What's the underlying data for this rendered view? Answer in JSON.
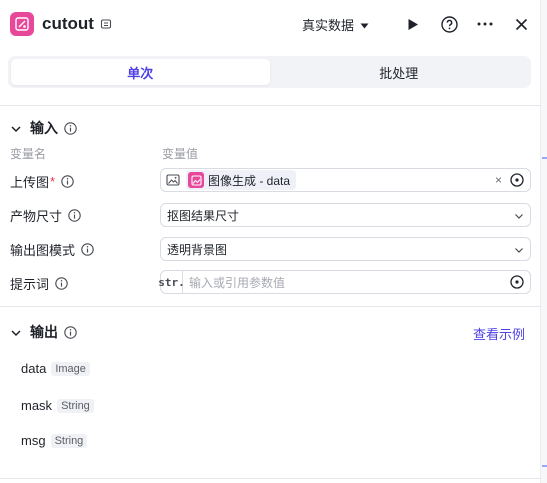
{
  "header": {
    "title": "cutout",
    "data_mode": "真实数据",
    "logo_icon": "magic-cut-icon",
    "accent": "#4e40e5",
    "brand": "#e8489a"
  },
  "tabs": [
    {
      "label": "单次",
      "active": true
    },
    {
      "label": "批处理",
      "active": false
    }
  ],
  "input": {
    "heading": "输入",
    "col_name": "变量名",
    "col_value": "变量值",
    "rows": [
      {
        "label": "上传图",
        "required": "*",
        "tag_text": "图像生成 - data"
      },
      {
        "label": "产物尺寸",
        "value": "抠图结果尺寸"
      },
      {
        "label": "输出图模式",
        "value": "透明背景图"
      },
      {
        "label": "提示词",
        "type_prefix": "str.",
        "placeholder": "输入或引用参数值"
      }
    ]
  },
  "output": {
    "heading": "输出",
    "view_example": "查看示例",
    "fields": [
      {
        "name": "data",
        "type": "Image"
      },
      {
        "name": "mask",
        "type": "String"
      },
      {
        "name": "msg",
        "type": "String"
      }
    ]
  }
}
